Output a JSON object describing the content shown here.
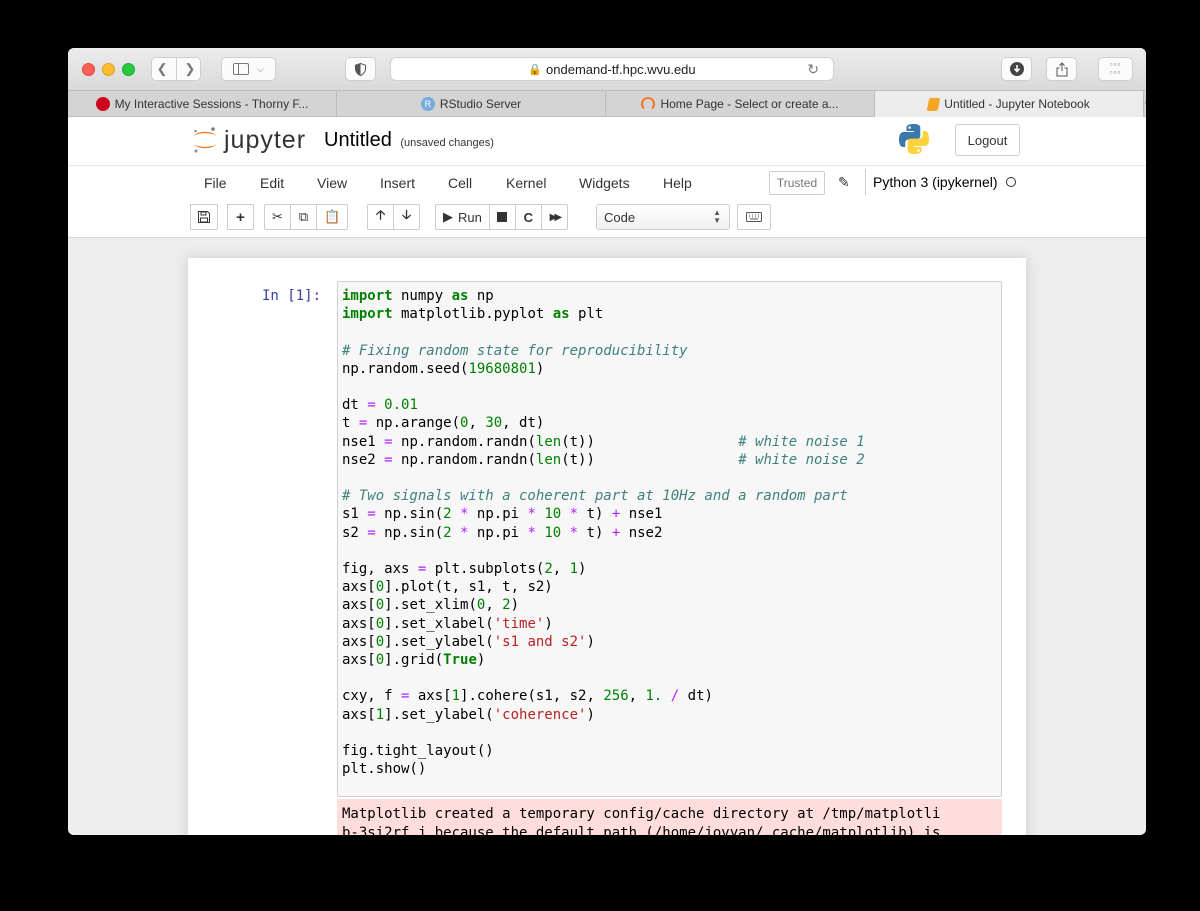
{
  "browser": {
    "url": "ondemand-tf.hpc.wvu.edu",
    "tabs": [
      {
        "label": "My Interactive Sessions - Thorny F...",
        "favicon_color": "#d0021b",
        "active": false
      },
      {
        "label": "RStudio Server",
        "favicon_color": "#75aadb",
        "active": false
      },
      {
        "label": "Home Page - Select or create a...",
        "favicon_color": "#f37726",
        "active": false
      },
      {
        "label": "Untitled - Jupyter Notebook",
        "favicon_color": "#f5a623",
        "active": true
      }
    ],
    "new_tab_label": "+"
  },
  "jupyter": {
    "logo_text": "jupyter",
    "notebook_name": "Untitled",
    "save_status": "(unsaved changes)",
    "logout_label": "Logout",
    "menu": [
      "File",
      "Edit",
      "View",
      "Insert",
      "Cell",
      "Kernel",
      "Widgets",
      "Help"
    ],
    "trusted_label": "Trusted",
    "kernel_name": "Python 3 (ipykernel)",
    "toolbar": {
      "run_label": "Run",
      "cell_type": "Code"
    }
  },
  "cell": {
    "prompt": "In [1]:",
    "stderr_lines": [
      "Matplotlib created a temporary config/cache directory at /tmp/matplotli",
      "b-3si2rf_j because the default path (/home/jovyan/.cache/matplotlib) is"
    ]
  },
  "colors": {
    "accent": "#f37726",
    "prompt": "#303f9f",
    "stderr_bg": "#ffdddd"
  }
}
